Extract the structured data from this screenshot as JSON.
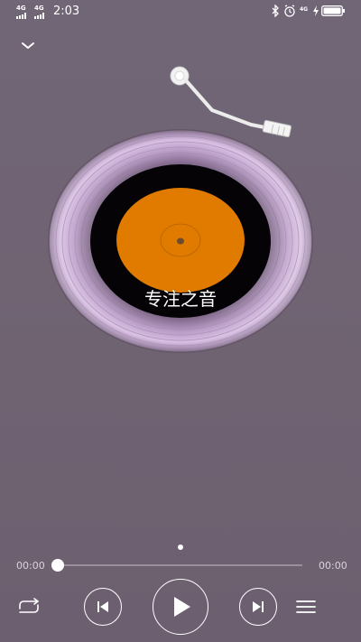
{
  "status_bar": {
    "signal_1_label": "4G",
    "signal_2_label": "4G",
    "time": "2:03",
    "icons": [
      "bluetooth-icon",
      "alarm-icon",
      "network-4g-icon",
      "charging-icon",
      "battery-icon"
    ],
    "network_label": "4G"
  },
  "header": {
    "collapse_icon": "chevron-down-icon"
  },
  "player": {
    "disc_label": "专注之音",
    "label_color": "#e07b00",
    "ring_color": "#c9a5d6",
    "page_indicator_count": 1
  },
  "progress": {
    "current": "00:00",
    "total": "00:00",
    "fraction": 0
  },
  "controls": {
    "icons": [
      "repeat-icon",
      "previous-icon",
      "play-icon",
      "next-icon",
      "playlist-icon"
    ]
  }
}
